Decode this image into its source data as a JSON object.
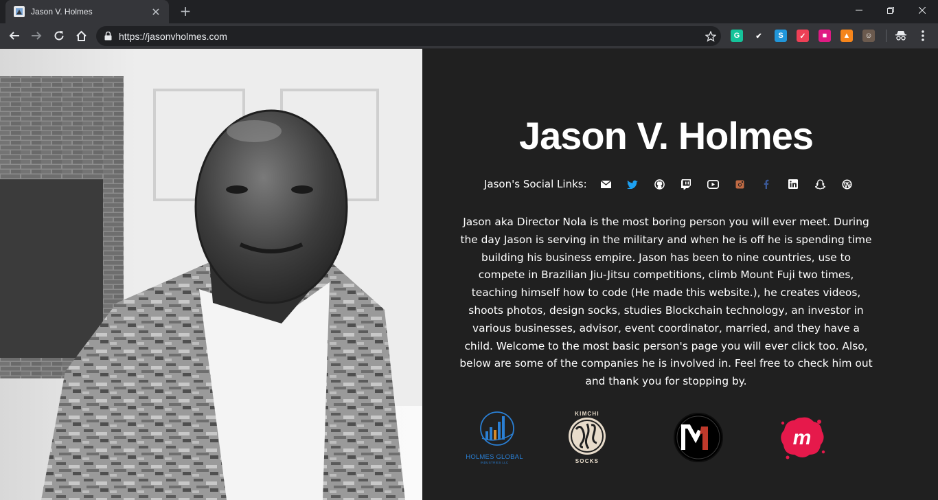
{
  "browser": {
    "tab_title": "Jason V. Holmes",
    "url": "https://jasonvholmes.com",
    "extensions": [
      {
        "name": "grammarly-icon",
        "glyph": "G",
        "color": "#15c39a"
      },
      {
        "name": "rocket-icon",
        "glyph": "✔",
        "color": "#35363a"
      },
      {
        "name": "skype-icon",
        "glyph": "S",
        "color": "#2196d9"
      },
      {
        "name": "pocket-icon",
        "glyph": "✓",
        "color": "#ee4056"
      },
      {
        "name": "toggl-icon",
        "glyph": "■",
        "color": "#e01b84"
      },
      {
        "name": "metamask-icon",
        "glyph": "▲",
        "color": "#f6851b"
      },
      {
        "name": "profile-avatar-icon",
        "glyph": "☺",
        "color": "#6b5a4e"
      }
    ]
  },
  "hero": {
    "title": "Jason V. Holmes",
    "social_label": "Jason's Social Links:",
    "social_links": [
      {
        "icon": "email-icon",
        "color": "#ffffff"
      },
      {
        "icon": "twitter-icon",
        "color": "#1da1f2"
      },
      {
        "icon": "github-icon",
        "color": "#ffffff"
      },
      {
        "icon": "twitch-icon",
        "color": "#ffffff"
      },
      {
        "icon": "youtube-icon",
        "color": "#ffffff"
      },
      {
        "icon": "instagram-icon",
        "color": "#c06a44"
      },
      {
        "icon": "facebook-icon",
        "color": "#3b5998"
      },
      {
        "icon": "linkedin-icon",
        "color": "#ffffff"
      },
      {
        "icon": "snapchat-icon",
        "color": "#ffffff"
      },
      {
        "icon": "wordpress-icon",
        "color": "#ffffff"
      }
    ],
    "bio": "Jason aka Director Nola is the most boring person you will ever meet. During the day Jason is serving in the military and when he is off he is spending time building his business empire. Jason has been to nine countries, use to compete in Brazilian Jiu-Jitsu competitions, climb Mount Fuji two times, teaching himself how to code (He made this website.), he creates videos, shoots photos, design socks, studies Blockchain technology, an investor in various businesses, advisor, event coordinator, married, and they have a child. Welcome to the most basic person's page you will ever click too. Also, below are some of the companies he is involved in. Feel free to check him out and thank you for stopping by."
  },
  "companies": [
    {
      "name": "HOLMES GLOBAL",
      "subtitle": "INDUSTRIES LLC",
      "color": "#2a7fd4"
    },
    {
      "name": "KIMCHI",
      "subtitle": "SOCKS",
      "color": "#e8dccb"
    },
    {
      "name": "M1",
      "color": "#c0392b"
    },
    {
      "name": "m",
      "color": "#e6194b"
    }
  ]
}
